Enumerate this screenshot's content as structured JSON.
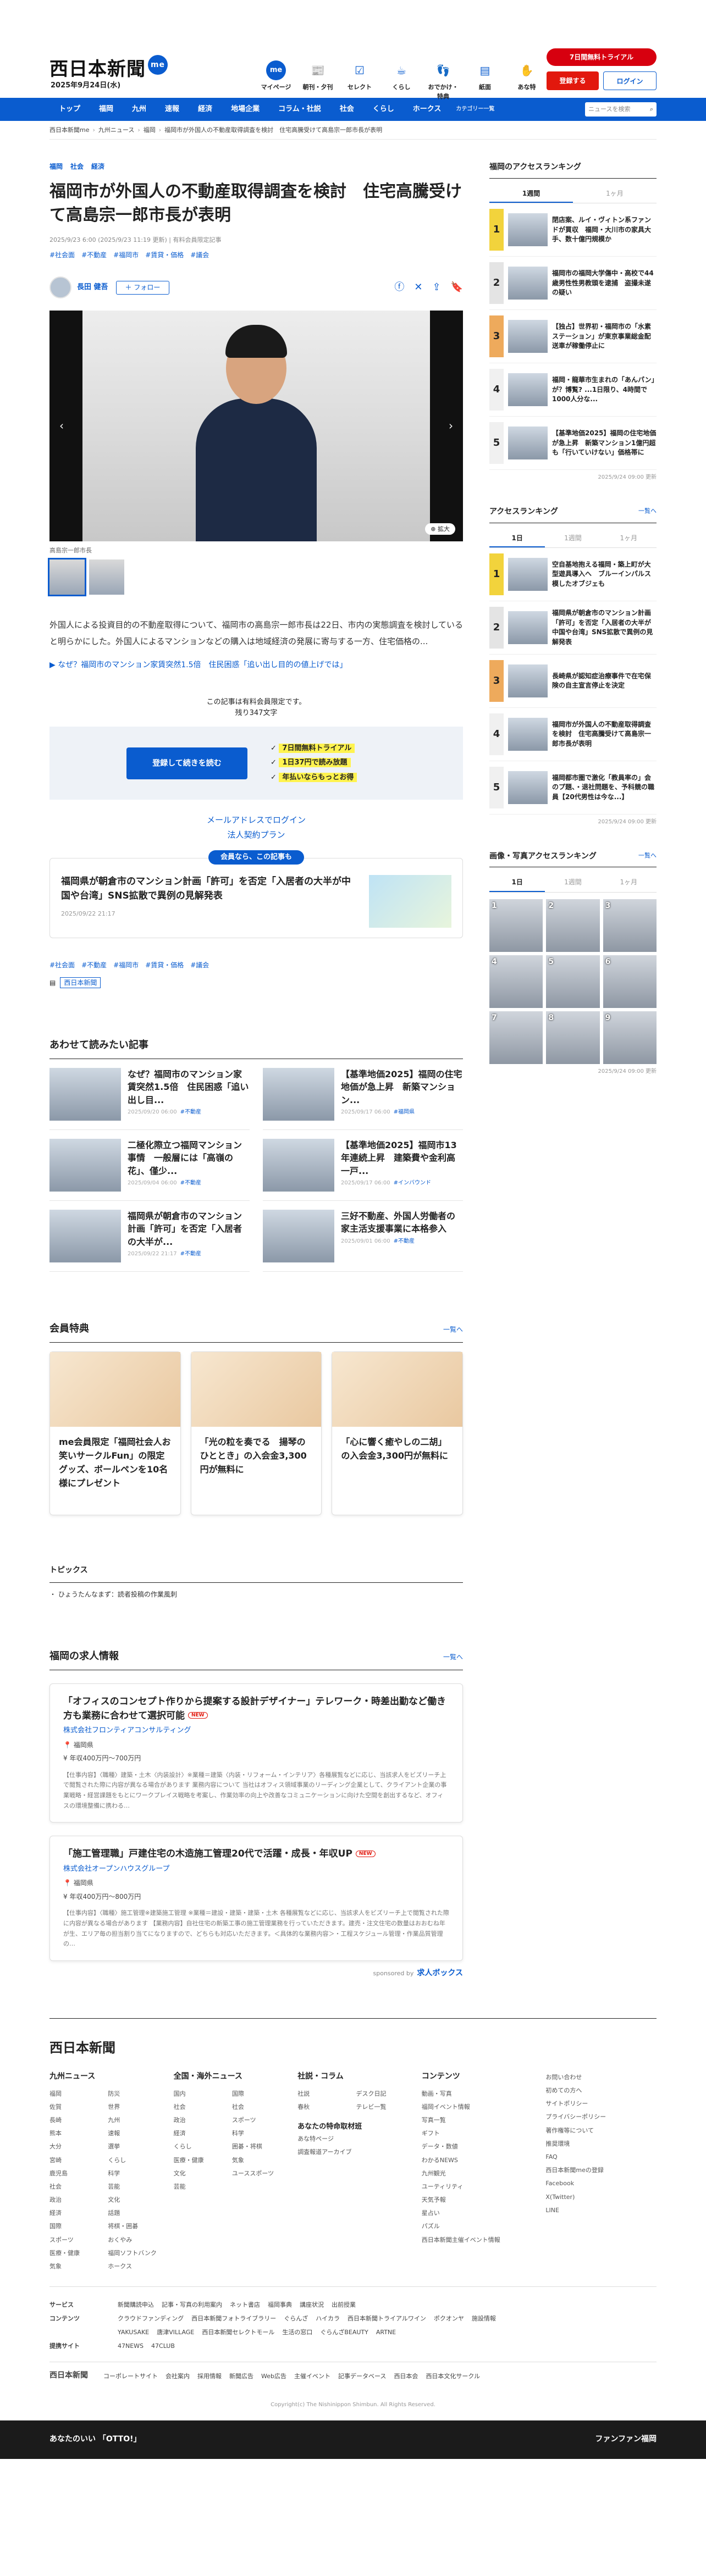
{
  "header": {
    "logo": "西日本新聞",
    "logo_badge": "me",
    "date": "2025年9月24日(水)",
    "icons": [
      {
        "label": "マイページ",
        "icon": "me-icon",
        "glyph": "me"
      },
      {
        "label": "朝刊・夕刊",
        "icon": "newspaper-icon",
        "glyph": "📰"
      },
      {
        "label": "セレクト",
        "icon": "select-icon",
        "glyph": "☑"
      },
      {
        "label": "くらし",
        "icon": "life-icon",
        "glyph": "☕"
      },
      {
        "label": "おでかけ・特典",
        "icon": "outing-icon",
        "glyph": "👣"
      },
      {
        "label": "紙面",
        "icon": "paper-icon",
        "glyph": "▤"
      },
      {
        "label": "あな特",
        "icon": "anatoku-icon",
        "glyph": "✋"
      }
    ],
    "trial_button": "7日間無料トライアル",
    "register_button": "登録する",
    "login_button": "ログイン"
  },
  "nav": {
    "items": [
      "トップ",
      "福岡",
      "九州",
      "速報",
      "経済",
      "地場企業",
      "コラム・社説",
      "社会",
      "くらし",
      "ホークス"
    ],
    "more": "カテゴリー一覧",
    "search_placeholder": "ニュースを検索"
  },
  "breadcrumb": [
    "西日本新聞me",
    "九州ニュース",
    "福岡",
    "福岡市が外国人の不動産取得調査を検討　住宅高騰受けて高島宗一郎市長が表明"
  ],
  "article": {
    "categories": [
      "福岡",
      "社会",
      "経済"
    ],
    "title": "福岡市が外国人の不動産取得調査を検討　住宅高騰受けて高島宗一郎市長が表明",
    "meta": "2025/9/23 6:00 (2025/9/23 11:19 更新) | 有料会員限定記事",
    "tags": [
      "#社会面",
      "#不動産",
      "#福岡市",
      "#賃貸・価格",
      "#議会"
    ],
    "author": "長田 健吾",
    "follow_label": "＋ フォロー",
    "zoom_label": "拡大",
    "caption": "高島宗一郎市長",
    "lead": "外国人による投資目的の不動産取得について、福岡市の高島宗一郎市長は22日、市内の実態調査を検討していると明らかにした。外国人によるマンションなどの購入は地域経済の発展に寄与する一方、住宅価格の...",
    "related_link": "なぜ？福岡市のマンション家賃突然1.5倍　住民困惑「追い出し目的の値上げでは」",
    "paywall_notice": "この記事は有料会員限定です。",
    "remaining": "残り347文字",
    "subscribe_button": "登録して続きを読む",
    "benefits": [
      "7日間無料トライアル",
      "1日37円で読み放題",
      "年払いならもっとお得"
    ],
    "email_login": "メールアドレスでログイン",
    "corporate_plan": "法人契約プラン",
    "members_pill": "会員なら、この記事も",
    "related_card_title": "福岡県が朝倉市のマンション計画「許可」を否定「入居者の大半が中国や台湾」SNS拡散で異例の見解発表",
    "related_card_date": "2025/09/22 21:17",
    "source_badge": "西日本新聞"
  },
  "recommended": {
    "heading": "あわせて読みたい記事",
    "items": [
      {
        "title": "なぜ？福岡市のマンション家賃突然1.5倍　住民困惑「追い出し目...",
        "date": "2025/09/20 06:00",
        "tag": "#不動産"
      },
      {
        "title": "【基準地価2025】福岡の住宅地価が急上昇　新築マンション...",
        "date": "2025/09/17 06:00",
        "tag": "#福岡県"
      },
      {
        "title": "二極化際立つ福岡マンション事情　一般層には「高嶺の花」、僅少...",
        "date": "2025/09/04 06:00",
        "tag": "#不動産"
      },
      {
        "title": "【基準地価2025】福岡市13年連続上昇　建築費や金利高　一戸...",
        "date": "2025/09/17 06:00",
        "tag": "#インバウンド"
      },
      {
        "title": "福岡県が朝倉市のマンション計画「許可」を否定「入居者の大半が...",
        "date": "2025/09/22 21:17",
        "tag": "#不動産"
      },
      {
        "title": "三好不動産、外国人労働者の家主活支援事業に本格参入",
        "date": "2025/09/01 06:00",
        "tag": "#不動産"
      }
    ]
  },
  "perks": {
    "heading": "会員特典",
    "more": "一覧へ",
    "items": [
      "me会員限定「福岡社会人お笑いサークルFun」の限定グッズ、ボールペンを10名様にプレゼント",
      "「光の粒を奏でる　揚琴のひととき」の入会金3,300円が無料に",
      "「心に響く癒やしの二胡」の入会金3,300円が無料に"
    ]
  },
  "topics": {
    "heading": "トピックス",
    "items": [
      "ひょうたんなまず：読者投稿の作業風刺"
    ]
  },
  "jobs": {
    "heading": "福岡の求人情報",
    "more": "一覧へ",
    "new_badge": "NEW",
    "items": [
      {
        "title": "「オフィスのコンセプト作りから提案する設計デザイナー」テレワーク・時差出勤など働き方も業務に合わせて選択可能",
        "company": "株式会社フロンティアコンサルティング",
        "location": "福岡県",
        "salary": "年収400万円〜700万円",
        "desc": "【仕事内容】〈職種〉建築・土木〈内装設計〉※業種＝建築〈内装・リフォーム・インテリア〉各種展覧などに応じ、当該求人をビズリーチ上で閲覧された際に内容が異なる場合があります 業務内容について 当社はオフィス領域事業のリーディング企業として、クライアント企業の事業戦略・経営課題をもとにワークプレイス戦略を考案し、作業効率の向上や改善なコミュニケーションに向けた空間を創出するなど、オフィスの環境整備に携わる…"
      },
      {
        "title": "「施工管理職」戸建住宅の木造施工管理20代で活躍・成長・年収UP",
        "company": "株式会社オープンハウスグループ",
        "location": "福岡県",
        "salary": "年収400万円〜800万円",
        "desc": "【仕事内容】〈職種〉施工管理※建築施工管理 ※業種＝建設・建築・建築・土木 各種展覧などに応じ、当該求人をビズリーチ上で閲覧された際に内容が異なる場合があります 【業務内容】自社住宅の新築工事の施工管理業務を行っていただきます。建売・注文住宅の数量はおおむね年が生、エリア毎の担当割り当てになりますので、どちらも対応いただきます。＜具体的な業務内容＞・工程スケジュール管理・作業品質管理の…"
      }
    ],
    "sponsor_prefix": "sponsored by",
    "sponsor": "求人ボックス"
  },
  "sidebar": {
    "fukuoka_ranking": {
      "heading": "福岡のアクセスランキング",
      "tabs": [
        "1週間",
        "1ヶ月"
      ],
      "items": [
        "閉店案、ルイ・ヴィトン系ファンドが買収　福岡・大川市の家具大手、数十億円規模か",
        "福岡市の福岡大学傷中・高校で44歳男性性男教頭を逮捕　盗撮未遂の疑い",
        "【独占】世界初・福岡市の「水素ステーション」が東京事業総金配送車が稼働停止に",
        "福岡・龍華市生まれの「あんパン」が？博覧? ...1日限り、4時間で1000人分な...",
        "【基準地価2025】福岡の住宅地価が急上昇　新築マンション1億円超も「行いていけない」価格帯に"
      ],
      "timestamp": "2025/9/24 09:00 更新"
    },
    "access_ranking": {
      "heading": "アクセスランキング",
      "more": "一覧へ",
      "tabs": [
        "1日",
        "1週間",
        "1ヶ月"
      ],
      "items": [
        "空自基地抱える福岡・築上町が大型遊具導入へ　ブルーインパルス模したオブジェも",
        "福岡県が朝倉市のマンション計画「許可」を否定「入居者の大半が中国や台湾」SNS拡散で異例の見解発表",
        "長崎県が認知症治療事件で在宅保険の自主宣言停止を決定",
        "福岡市が外国人の不動産取得調査を検討　住宅高騰受けて高島宗一郎市長が表明",
        "福岡都市圏で激化「教員率の」会のプ題、・退社問題を、予科競の職員【20代男性は今な...】"
      ],
      "timestamp": "2025/9/24 09:00 更新"
    },
    "photo_ranking": {
      "heading": "画像・写真アクセスランキング",
      "more": "一覧へ",
      "tabs": [
        "1日",
        "1週間",
        "1ヶ月"
      ],
      "labels": [
        "1",
        "2",
        "3",
        "4",
        "5",
        "6",
        "7",
        "8",
        "9"
      ],
      "timestamp": "2025/9/24 09:00 更新"
    }
  },
  "footer": {
    "logo": "西日本新聞",
    "columns": [
      {
        "heading": "九州ニュース",
        "items": [
          "福岡",
          "佐賀",
          "長崎",
          "熊本",
          "大分",
          "宮崎",
          "鹿児島",
          "社会",
          "政治",
          "経済",
          "国際",
          "スポーツ",
          "医療・健康",
          "気象",
          "防災",
          "世界",
          "九州",
          "速報",
          "選挙",
          "くらし",
          "科学",
          "芸能",
          "文化",
          "話題",
          "将棋・囲碁",
          "おくやみ",
          "福岡ソフトバンクホークス"
        ]
      },
      {
        "heading": "全国・海外ニュース",
        "items": [
          "国内",
          "社会",
          "政治",
          "経済",
          "くらし",
          "医療・健康",
          "文化",
          "芸能",
          "国際",
          "社会",
          "スポーツ",
          "科学",
          "囲碁・将棋",
          "気象",
          "ユーススポーツ"
        ]
      },
      {
        "heading": "社説・コラム",
        "items": [
          "社説",
          "春秋",
          "デスク日記",
          "テレビ一覧"
        ],
        "sub": "あなたの特命取材班",
        "sub_items": [
          "あな特ページ",
          "調査報道アーカイブ"
        ]
      },
      {
        "heading": "コンテンツ",
        "items": [
          "動画・写真",
          "福岡イベント情報",
          "写真一覧",
          "ギフト",
          "データ・数値",
          "わかるNEWS",
          "九州観光",
          "ユーティリティ",
          "天気予報",
          "星占い",
          "パズル",
          "西日本新聞主催イベント情報"
        ]
      },
      {
        "heading": "",
        "items": [
          "お問い合わせ",
          "初めての方へ",
          "サイトポリシー",
          "プライバシーポリシー",
          "著作権等について",
          "推奨環境",
          "FAQ",
          "西日本新聞meの登録",
          "Facebook",
          "X(Twitter)",
          "LINE"
        ]
      }
    ],
    "rows": [
      {
        "label": "サービス",
        "items": [
          "新聞購読申込",
          "記事・写真の利用案内",
          "ネット書店",
          "福岡事典",
          "講座状況",
          "出前授業"
        ]
      },
      {
        "label": "コンテンツ",
        "items": [
          "クラウドファンディング",
          "西日本新聞フォトライブラリー",
          "ぐらんざ",
          "ハイカラ",
          "西日本新聞トライアルワイン",
          "ポクオンヤ",
          "施設情報"
        ]
      },
      {
        "label": "",
        "items": [
          "YAKUSAKE",
          "唐津VILLAGE",
          "西日本新聞セレクトモール",
          "生活の窓口",
          "ぐらんざBEAUTY",
          "ARTNE"
        ]
      },
      {
        "label": "提携サイト",
        "items": [
          "47NEWS",
          "47CLUB"
        ]
      }
    ],
    "bottom": {
      "logo": "西日本新聞",
      "items": [
        "コーポレートサイト",
        "会社案内",
        "採用情報",
        "新聞広告",
        "Web広告",
        "主催イベント",
        "記事データベース",
        "西日本会",
        "西日本文化サークル"
      ]
    },
    "copyright": "Copyright(c) The Nishinippon Shimbun. All Rights Reserved.",
    "ad_left": "あなたのいい 「OTTO!」",
    "ad_right": "ファンファン福岡"
  }
}
